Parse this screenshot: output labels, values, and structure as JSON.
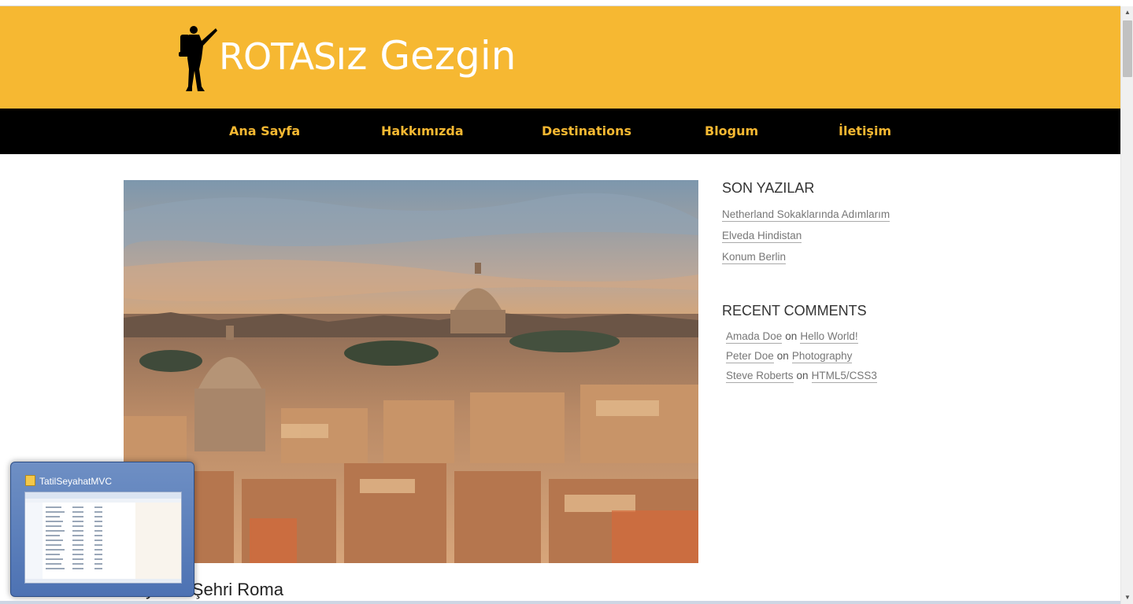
{
  "site": {
    "logo_caps": "ROTAS",
    "logo_small": "ız",
    "logo_rest": " Gezgin"
  },
  "nav": {
    "items": [
      {
        "label": "Ana Sayfa"
      },
      {
        "label": "Hakkımızda"
      },
      {
        "label": "Destinations"
      },
      {
        "label": "Blogum"
      },
      {
        "label": "İletişim"
      }
    ]
  },
  "post": {
    "title": "Hayaller Şehri Roma"
  },
  "sidebar": {
    "recent_title": "SON YAZILAR",
    "recent_posts": [
      {
        "label": "Netherland Sokaklarında Adımlarım"
      },
      {
        "label": "Elveda Hindistan"
      },
      {
        "label": "Konum Berlin"
      }
    ],
    "comments_title": "RECENT COMMENTS",
    "comments": [
      {
        "author": "Amada Doe",
        "on": "on",
        "post": "Hello World!"
      },
      {
        "author": "Peter Doe",
        "on": "on",
        "post": "Photography"
      },
      {
        "author": "Steve Roberts",
        "on": "on",
        "post": "HTML5/CSS3"
      }
    ]
  },
  "taskbar_preview": {
    "title": "TatilSeyahatMVC"
  },
  "colors": {
    "brand": "#f6b832",
    "nav_bg": "#000000"
  }
}
